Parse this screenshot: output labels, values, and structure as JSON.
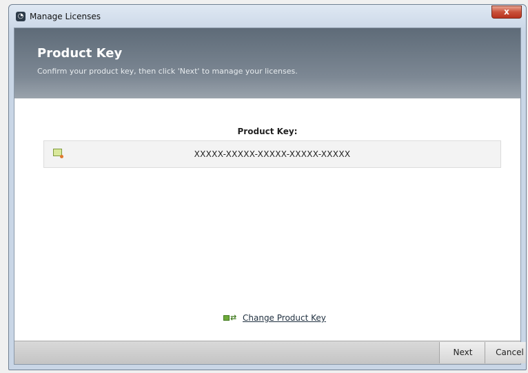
{
  "window": {
    "title": "Manage Licenses",
    "close_label": "x"
  },
  "header": {
    "title": "Product Key",
    "subtitle": "Confirm your product key, then click 'Next' to manage your licenses."
  },
  "product_key": {
    "label": "Product Key:",
    "value": "XXXXX-XXXXX-XXXXX-XXXXX-XXXXX",
    "icon": "license-certificate-icon"
  },
  "change_key": {
    "label": "Change Product Key",
    "icon": "change-key-icon"
  },
  "footer": {
    "next_label": "Next",
    "cancel_label": "Cancel"
  }
}
